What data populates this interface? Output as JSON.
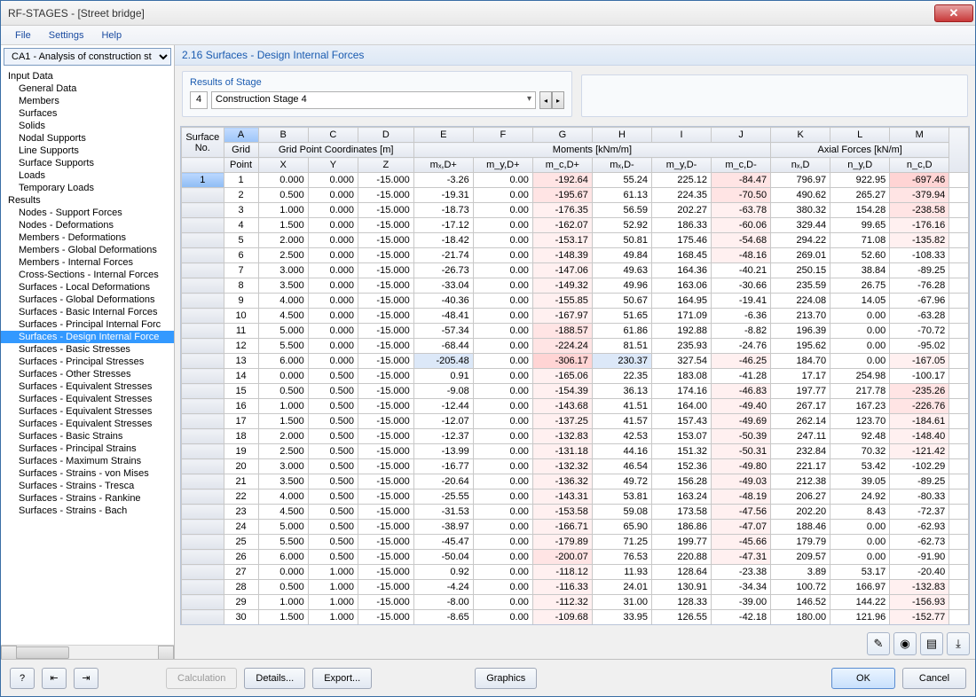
{
  "window": {
    "title": "RF-STAGES - [Street bridge]"
  },
  "menu": {
    "file": "File",
    "settings": "Settings",
    "help": "Help"
  },
  "left": {
    "combo": "CA1 - Analysis of construction st",
    "tree": [
      {
        "label": "Input Data",
        "lvl": 0
      },
      {
        "label": "General Data",
        "lvl": 1
      },
      {
        "label": "Members",
        "lvl": 1
      },
      {
        "label": "Surfaces",
        "lvl": 1
      },
      {
        "label": "Solids",
        "lvl": 1
      },
      {
        "label": "Nodal Supports",
        "lvl": 1
      },
      {
        "label": "Line Supports",
        "lvl": 1
      },
      {
        "label": "Surface Supports",
        "lvl": 1
      },
      {
        "label": "Loads",
        "lvl": 1
      },
      {
        "label": "Temporary Loads",
        "lvl": 1
      },
      {
        "label": "Results",
        "lvl": 0
      },
      {
        "label": "Nodes - Support Forces",
        "lvl": 1
      },
      {
        "label": "Nodes - Deformations",
        "lvl": 1
      },
      {
        "label": "Members - Deformations",
        "lvl": 1
      },
      {
        "label": "Members - Global Deformations",
        "lvl": 1
      },
      {
        "label": "Members - Internal Forces",
        "lvl": 1
      },
      {
        "label": "Cross-Sections - Internal Forces",
        "lvl": 1
      },
      {
        "label": "Surfaces - Local Deformations",
        "lvl": 1
      },
      {
        "label": "Surfaces - Global Deformations",
        "lvl": 1
      },
      {
        "label": "Surfaces - Basic Internal Forces",
        "lvl": 1
      },
      {
        "label": "Surfaces - Principal Internal Forc",
        "lvl": 1
      },
      {
        "label": "Surfaces - Design Internal Force",
        "lvl": 1,
        "sel": true
      },
      {
        "label": "Surfaces - Basic Stresses",
        "lvl": 1
      },
      {
        "label": "Surfaces - Principal Stresses",
        "lvl": 1
      },
      {
        "label": "Surfaces - Other Stresses",
        "lvl": 1
      },
      {
        "label": "Surfaces - Equivalent Stresses",
        "lvl": 1
      },
      {
        "label": "Surfaces - Equivalent Stresses",
        "lvl": 1
      },
      {
        "label": "Surfaces - Equivalent Stresses",
        "lvl": 1
      },
      {
        "label": "Surfaces - Equivalent Stresses",
        "lvl": 1
      },
      {
        "label": "Surfaces - Basic Strains",
        "lvl": 1
      },
      {
        "label": "Surfaces - Principal Strains",
        "lvl": 1
      },
      {
        "label": "Surfaces - Maximum Strains",
        "lvl": 1
      },
      {
        "label": "Surfaces - Strains - von Mises",
        "lvl": 1
      },
      {
        "label": "Surfaces - Strains - Tresca",
        "lvl": 1
      },
      {
        "label": "Surfaces - Strains - Rankine",
        "lvl": 1
      },
      {
        "label": "Surfaces - Strains - Bach",
        "lvl": 1
      }
    ]
  },
  "main": {
    "title": "2.16 Surfaces - Design Internal Forces",
    "stage_label": "Results of Stage",
    "stage_num": "4",
    "stage_name": "Construction Stage 4",
    "colLetters": [
      "A",
      "B",
      "C",
      "D",
      "E",
      "F",
      "G",
      "H",
      "I",
      "J",
      "K",
      "L",
      "M"
    ],
    "groupHdr": {
      "surface": "Surface",
      "grid": "Grid",
      "coords": "Grid Point Coordinates [m]",
      "moments": "Moments [kNm/m]",
      "axial": "Axial Forces [kN/m]"
    },
    "hdr2": {
      "no": "No.",
      "point": "Point",
      "x": "X",
      "y": "Y",
      "z": "Z",
      "mxdp": "mₓ,D+",
      "mydp": "m_y,D+",
      "mcdp": "m_c,D+",
      "mxdm": "mₓ,D-",
      "mydm": "m_y,D-",
      "mcdm": "m_c,D-",
      "nxd": "nₓ,D",
      "nyd": "n_y,D",
      "ncd": "n_c,D"
    },
    "rows": [
      {
        "surf": "1",
        "gp": "1",
        "x": "0.000",
        "y": "0.000",
        "z": "-15.000",
        "mxdp": "-3.26",
        "mydp": "0.00",
        "mcdp": "-192.64",
        "mxdm": "55.24",
        "mydm": "225.12",
        "mcdm": "-84.47",
        "nxd": "796.97",
        "nyd": "922.95",
        "ncd": "-697.46"
      },
      {
        "gp": "2",
        "x": "0.500",
        "y": "0.000",
        "z": "-15.000",
        "mxdp": "-19.31",
        "mydp": "0.00",
        "mcdp": "-195.67",
        "mxdm": "61.13",
        "mydm": "224.35",
        "mcdm": "-70.50",
        "nxd": "490.62",
        "nyd": "265.27",
        "ncd": "-379.94"
      },
      {
        "gp": "3",
        "x": "1.000",
        "y": "0.000",
        "z": "-15.000",
        "mxdp": "-18.73",
        "mydp": "0.00",
        "mcdp": "-176.35",
        "mxdm": "56.59",
        "mydm": "202.27",
        "mcdm": "-63.78",
        "nxd": "380.32",
        "nyd": "154.28",
        "ncd": "-238.58"
      },
      {
        "gp": "4",
        "x": "1.500",
        "y": "0.000",
        "z": "-15.000",
        "mxdp": "-17.12",
        "mydp": "0.00",
        "mcdp": "-162.07",
        "mxdm": "52.92",
        "mydm": "186.33",
        "mcdm": "-60.06",
        "nxd": "329.44",
        "nyd": "99.65",
        "ncd": "-176.16"
      },
      {
        "gp": "5",
        "x": "2.000",
        "y": "0.000",
        "z": "-15.000",
        "mxdp": "-18.42",
        "mydp": "0.00",
        "mcdp": "-153.17",
        "mxdm": "50.81",
        "mydm": "175.46",
        "mcdm": "-54.68",
        "nxd": "294.22",
        "nyd": "71.08",
        "ncd": "-135.82"
      },
      {
        "gp": "6",
        "x": "2.500",
        "y": "0.000",
        "z": "-15.000",
        "mxdp": "-21.74",
        "mydp": "0.00",
        "mcdp": "-148.39",
        "mxdm": "49.84",
        "mydm": "168.45",
        "mcdm": "-48.16",
        "nxd": "269.01",
        "nyd": "52.60",
        "ncd": "-108.33"
      },
      {
        "gp": "7",
        "x": "3.000",
        "y": "0.000",
        "z": "-15.000",
        "mxdp": "-26.73",
        "mydp": "0.00",
        "mcdp": "-147.06",
        "mxdm": "49.63",
        "mydm": "164.36",
        "mcdm": "-40.21",
        "nxd": "250.15",
        "nyd": "38.84",
        "ncd": "-89.25"
      },
      {
        "gp": "8",
        "x": "3.500",
        "y": "0.000",
        "z": "-15.000",
        "mxdp": "-33.04",
        "mydp": "0.00",
        "mcdp": "-149.32",
        "mxdm": "49.96",
        "mydm": "163.06",
        "mcdm": "-30.66",
        "nxd": "235.59",
        "nyd": "26.75",
        "ncd": "-76.28"
      },
      {
        "gp": "9",
        "x": "4.000",
        "y": "0.000",
        "z": "-15.000",
        "mxdp": "-40.36",
        "mydp": "0.00",
        "mcdp": "-155.85",
        "mxdm": "50.67",
        "mydm": "164.95",
        "mcdm": "-19.41",
        "nxd": "224.08",
        "nyd": "14.05",
        "ncd": "-67.96"
      },
      {
        "gp": "10",
        "x": "4.500",
        "y": "0.000",
        "z": "-15.000",
        "mxdp": "-48.41",
        "mydp": "0.00",
        "mcdp": "-167.97",
        "mxdm": "51.65",
        "mydm": "171.09",
        "mcdm": "-6.36",
        "nxd": "213.70",
        "nyd": "0.00",
        "ncd": "-63.28"
      },
      {
        "gp": "11",
        "x": "5.000",
        "y": "0.000",
        "z": "-15.000",
        "mxdp": "-57.34",
        "mydp": "0.00",
        "mcdp": "-188.57",
        "mxdm": "61.86",
        "mydm": "192.88",
        "mcdm": "-8.82",
        "nxd": "196.39",
        "nyd": "0.00",
        "ncd": "-70.72"
      },
      {
        "gp": "12",
        "x": "5.500",
        "y": "0.000",
        "z": "-15.000",
        "mxdp": "-68.44",
        "mydp": "0.00",
        "mcdp": "-224.24",
        "mxdm": "81.51",
        "mydm": "235.93",
        "mcdm": "-24.76",
        "nxd": "195.62",
        "nyd": "0.00",
        "ncd": "-95.02"
      },
      {
        "gp": "13",
        "x": "6.000",
        "y": "0.000",
        "z": "-15.000",
        "mxdp": "-205.48",
        "mydp": "0.00",
        "mcdp": "-306.17",
        "mxdm": "230.37",
        "mydm": "327.54",
        "mcdm": "-46.25",
        "nxd": "184.70",
        "nyd": "0.00",
        "ncd": "-167.05"
      },
      {
        "gp": "14",
        "x": "0.000",
        "y": "0.500",
        "z": "-15.000",
        "mxdp": "0.91",
        "mydp": "0.00",
        "mcdp": "-165.06",
        "mxdm": "22.35",
        "mydm": "183.08",
        "mcdm": "-41.28",
        "nxd": "17.17",
        "nyd": "254.98",
        "ncd": "-100.17"
      },
      {
        "gp": "15",
        "x": "0.500",
        "y": "0.500",
        "z": "-15.000",
        "mxdp": "-9.08",
        "mydp": "0.00",
        "mcdp": "-154.39",
        "mxdm": "36.13",
        "mydm": "174.16",
        "mcdm": "-46.83",
        "nxd": "197.77",
        "nyd": "217.78",
        "ncd": "-235.26"
      },
      {
        "gp": "16",
        "x": "1.000",
        "y": "0.500",
        "z": "-15.000",
        "mxdp": "-12.44",
        "mydp": "0.00",
        "mcdp": "-143.68",
        "mxdm": "41.51",
        "mydm": "164.00",
        "mcdm": "-49.40",
        "nxd": "267.17",
        "nyd": "167.23",
        "ncd": "-226.76"
      },
      {
        "gp": "17",
        "x": "1.500",
        "y": "0.500",
        "z": "-15.000",
        "mxdp": "-12.07",
        "mydp": "0.00",
        "mcdp": "-137.25",
        "mxdm": "41.57",
        "mydm": "157.43",
        "mcdm": "-49.69",
        "nxd": "262.14",
        "nyd": "123.70",
        "ncd": "-184.61"
      },
      {
        "gp": "18",
        "x": "2.000",
        "y": "0.500",
        "z": "-15.000",
        "mxdp": "-12.37",
        "mydp": "0.00",
        "mcdp": "-132.83",
        "mxdm": "42.53",
        "mydm": "153.07",
        "mcdm": "-50.39",
        "nxd": "247.11",
        "nyd": "92.48",
        "ncd": "-148.40"
      },
      {
        "gp": "19",
        "x": "2.500",
        "y": "0.500",
        "z": "-15.000",
        "mxdp": "-13.99",
        "mydp": "0.00",
        "mcdp": "-131.18",
        "mxdm": "44.16",
        "mydm": "151.32",
        "mcdm": "-50.31",
        "nxd": "232.84",
        "nyd": "70.32",
        "ncd": "-121.42"
      },
      {
        "gp": "20",
        "x": "3.000",
        "y": "0.500",
        "z": "-15.000",
        "mxdp": "-16.77",
        "mydp": "0.00",
        "mcdp": "-132.32",
        "mxdm": "46.54",
        "mydm": "152.36",
        "mcdm": "-49.80",
        "nxd": "221.17",
        "nyd": "53.42",
        "ncd": "-102.29"
      },
      {
        "gp": "21",
        "x": "3.500",
        "y": "0.500",
        "z": "-15.000",
        "mxdp": "-20.64",
        "mydp": "0.00",
        "mcdp": "-136.32",
        "mxdm": "49.72",
        "mydm": "156.28",
        "mcdm": "-49.03",
        "nxd": "212.38",
        "nyd": "39.05",
        "ncd": "-89.25"
      },
      {
        "gp": "22",
        "x": "4.000",
        "y": "0.500",
        "z": "-15.000",
        "mxdp": "-25.55",
        "mydp": "0.00",
        "mcdp": "-143.31",
        "mxdm": "53.81",
        "mydm": "163.24",
        "mcdm": "-48.19",
        "nxd": "206.27",
        "nyd": "24.92",
        "ncd": "-80.33"
      },
      {
        "gp": "23",
        "x": "4.500",
        "y": "0.500",
        "z": "-15.000",
        "mxdp": "-31.53",
        "mydp": "0.00",
        "mcdp": "-153.58",
        "mxdm": "59.08",
        "mydm": "173.58",
        "mcdm": "-47.56",
        "nxd": "202.20",
        "nyd": "8.43",
        "ncd": "-72.37"
      },
      {
        "gp": "24",
        "x": "5.000",
        "y": "0.500",
        "z": "-15.000",
        "mxdp": "-38.97",
        "mydp": "0.00",
        "mcdp": "-166.71",
        "mxdm": "65.90",
        "mydm": "186.86",
        "mcdm": "-47.07",
        "nxd": "188.46",
        "nyd": "0.00",
        "ncd": "-62.93"
      },
      {
        "gp": "25",
        "x": "5.500",
        "y": "0.500",
        "z": "-15.000",
        "mxdp": "-45.47",
        "mydp": "0.00",
        "mcdp": "-179.89",
        "mxdm": "71.25",
        "mydm": "199.77",
        "mcdm": "-45.66",
        "nxd": "179.79",
        "nyd": "0.00",
        "ncd": "-62.73"
      },
      {
        "gp": "26",
        "x": "6.000",
        "y": "0.500",
        "z": "-15.000",
        "mxdp": "-50.04",
        "mydp": "0.00",
        "mcdp": "-200.07",
        "mxdm": "76.53",
        "mydm": "220.88",
        "mcdm": "-47.31",
        "nxd": "209.57",
        "nyd": "0.00",
        "ncd": "-91.90"
      },
      {
        "gp": "27",
        "x": "0.000",
        "y": "1.000",
        "z": "-15.000",
        "mxdp": "0.92",
        "mydp": "0.00",
        "mcdp": "-118.12",
        "mxdm": "11.93",
        "mydm": "128.64",
        "mcdm": "-23.38",
        "nxd": "3.89",
        "nyd": "53.17",
        "ncd": "-20.40"
      },
      {
        "gp": "28",
        "x": "0.500",
        "y": "1.000",
        "z": "-15.000",
        "mxdp": "-4.24",
        "mydp": "0.00",
        "mcdp": "-116.33",
        "mxdm": "24.01",
        "mydm": "130.91",
        "mcdm": "-34.34",
        "nxd": "100.72",
        "nyd": "166.97",
        "ncd": "-132.83"
      },
      {
        "gp": "29",
        "x": "1.000",
        "y": "1.000",
        "z": "-15.000",
        "mxdp": "-8.00",
        "mydp": "0.00",
        "mcdp": "-112.32",
        "mxdm": "31.00",
        "mydm": "128.33",
        "mcdm": "-39.00",
        "nxd": "146.52",
        "nyd": "144.22",
        "ncd": "-156.93"
      },
      {
        "gp": "30",
        "x": "1.500",
        "y": "1.000",
        "z": "-15.000",
        "mxdp": "-8.65",
        "mydp": "0.00",
        "mcdp": "-109.68",
        "mxdm": "33.95",
        "mydm": "126.55",
        "mcdm": "-42.18",
        "nxd": "180.00",
        "nyd": "121.96",
        "ncd": "-152.77"
      }
    ]
  },
  "footer": {
    "calculation": "Calculation",
    "details": "Details...",
    "export": "Export...",
    "graphics": "Graphics",
    "ok": "OK",
    "cancel": "Cancel"
  }
}
